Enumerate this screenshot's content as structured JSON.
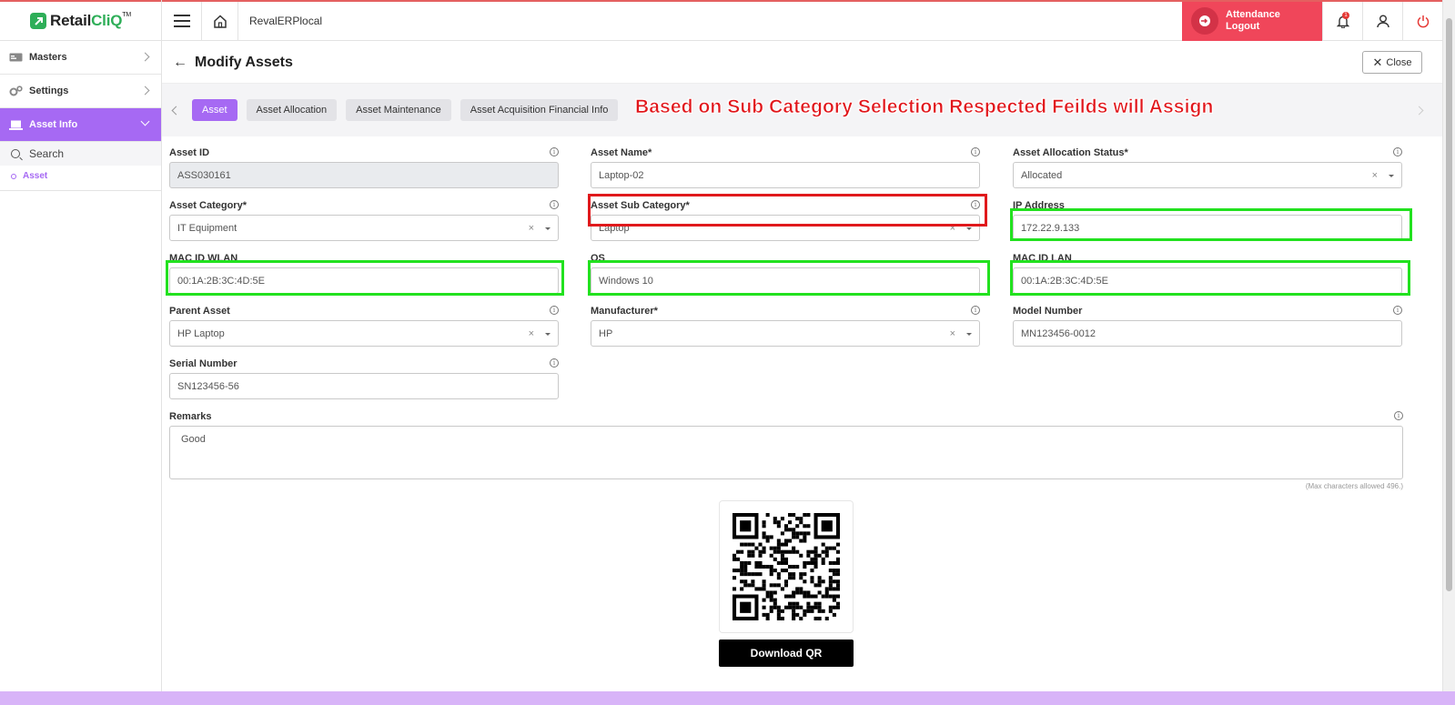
{
  "brand": {
    "name_part1": "Retail",
    "name_part2": "CliQ",
    "tm": "TM"
  },
  "sidebar": {
    "items": [
      {
        "label": "Masters",
        "icon": "masters-icon"
      },
      {
        "label": "Settings",
        "icon": "gears-icon"
      },
      {
        "label": "Asset Info",
        "icon": "laptop-icon",
        "active": true
      }
    ],
    "search_label": "Search",
    "sub_item": "Asset"
  },
  "topbar": {
    "company": "RevalERPlocal",
    "attendance_line1": "Attendance",
    "attendance_line2": "Logout",
    "notification_count": "1"
  },
  "page": {
    "title": "Modify Assets",
    "close_label": "Close"
  },
  "tabs": [
    "Asset",
    "Asset Allocation",
    "Asset Maintenance",
    "Asset Acquisition Financial Info"
  ],
  "annotation": "Based on Sub Category Selection Respected Feilds will Assign",
  "fields": {
    "asset_id": {
      "label": "Asset ID",
      "value": "ASS030161"
    },
    "asset_name": {
      "label": "Asset Name*",
      "value": "Laptop-02"
    },
    "allocation_status": {
      "label": "Asset Allocation Status*",
      "value": "Allocated"
    },
    "asset_category": {
      "label": "Asset Category*",
      "value": "IT Equipment"
    },
    "asset_sub_category": {
      "label": "Asset Sub Category*",
      "value": "Laptop"
    },
    "ip_address": {
      "label": "IP Address",
      "value": "172.22.9.133"
    },
    "mac_wlan": {
      "label": "MAC ID WLAN",
      "value": "00:1A:2B:3C:4D:5E"
    },
    "os": {
      "label": "OS",
      "value": "Windows 10"
    },
    "mac_lan": {
      "label": "MAC ID LAN",
      "value": "00:1A:2B:3C:4D:5E"
    },
    "parent_asset": {
      "label": "Parent Asset",
      "value": "HP Laptop"
    },
    "manufacturer": {
      "label": "Manufacturer*",
      "value": "HP"
    },
    "model_number": {
      "label": "Model Number",
      "value": "MN123456-0012"
    },
    "serial_number": {
      "label": "Serial Number",
      "value": "SN123456-56"
    },
    "remarks": {
      "label": "Remarks",
      "value": "Good"
    }
  },
  "max_chars_note": "(Max characters allowed 496.)",
  "download_qr_label": "Download QR",
  "colors": {
    "accent": "#a669f3",
    "brand_green": "#2eae58",
    "attendance_red": "#f0465a",
    "highlight_green": "#22e11f",
    "highlight_red": "#e0191c"
  }
}
